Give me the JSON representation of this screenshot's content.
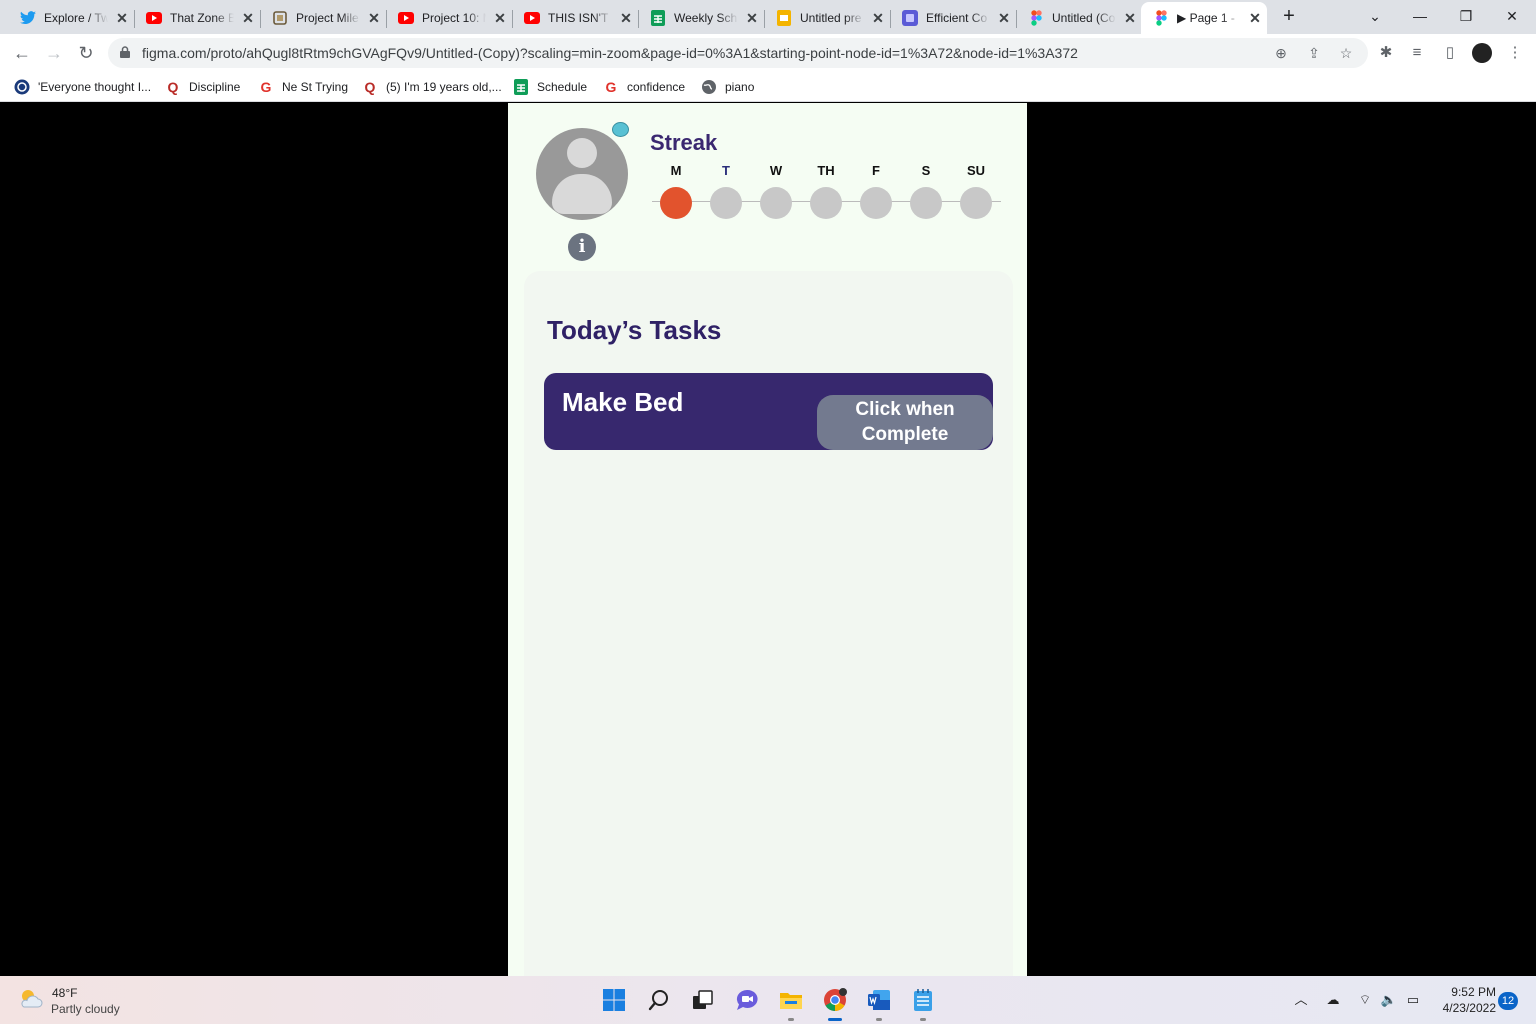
{
  "browser": {
    "tabs": [
      {
        "title": "Explore / Tw",
        "icon": "twitter-icon",
        "color": "#1d9bf0"
      },
      {
        "title": "That Zone B",
        "icon": "youtube-icon",
        "color": "#ff0000"
      },
      {
        "title": "Project Mile",
        "icon": "book-icon",
        "color": "#8a6d3b"
      },
      {
        "title": "Project 10: M",
        "icon": "youtube-icon",
        "color": "#ff0000"
      },
      {
        "title": "THIS ISN'T M",
        "icon": "youtube-icon",
        "color": "#ff0000"
      },
      {
        "title": "Weekly Sch",
        "icon": "sheets-icon",
        "color": "#0f9d58"
      },
      {
        "title": "Untitled pre",
        "icon": "slides-icon",
        "color": "#f4b400"
      },
      {
        "title": "Efficient Co",
        "icon": "app-icon",
        "color": "#5b5bd6"
      },
      {
        "title": "Untitled (Co",
        "icon": "figma-icon",
        "color": "#f24e1e"
      },
      {
        "title": "▶ Page 1 -",
        "icon": "figma-icon",
        "color": "#f24e1e",
        "active": true
      }
    ],
    "new_tab": "+",
    "window_controls": {
      "tab_search": "⌄",
      "minimize": "—",
      "restore": "❐",
      "close": "✕"
    },
    "url": "figma.com/proto/ahQugl8tRtm9chGVAgFQv9/Untitled-(Copy)?scaling=min-zoom&page-id=0%3A1&starting-point-node-id=1%3A72&node-id=1%3A372",
    "bookmarks": [
      {
        "label": "'Everyone thought I...",
        "icon": "globe-dark-icon"
      },
      {
        "label": "Discipline",
        "icon": "quora-icon"
      },
      {
        "label": "Ne St Trying",
        "icon": "g-icon"
      },
      {
        "label": "(5) I'm 19 years old,...",
        "icon": "quora-icon"
      },
      {
        "label": "Schedule",
        "icon": "sheets-icon"
      },
      {
        "label": "confidence",
        "icon": "g-icon"
      },
      {
        "label": "piano",
        "icon": "globe-icon"
      }
    ]
  },
  "app": {
    "streak_title": "Streak",
    "days": [
      {
        "label": "M",
        "done": true
      },
      {
        "label": "T",
        "done": false,
        "current": true
      },
      {
        "label": "W",
        "done": false
      },
      {
        "label": "TH",
        "done": false
      },
      {
        "label": "F",
        "done": false
      },
      {
        "label": "S",
        "done": false
      },
      {
        "label": "SU",
        "done": false
      }
    ],
    "info_glyph": "i",
    "tasks_title": "Today’s Tasks",
    "tasks": [
      {
        "name": "Make Bed",
        "button_label": "Click when Complete"
      }
    ],
    "colors": {
      "primary": "#37286e",
      "streak_done": "#e2532d",
      "streak_empty": "#c8c8c8",
      "button": "#737a8f",
      "status_dot": "#58c1d3"
    }
  },
  "taskbar": {
    "weather_temp": "48°F",
    "weather_desc": "Partly cloudy",
    "time": "9:52 PM",
    "date": "4/23/2022",
    "notifications": "12"
  }
}
